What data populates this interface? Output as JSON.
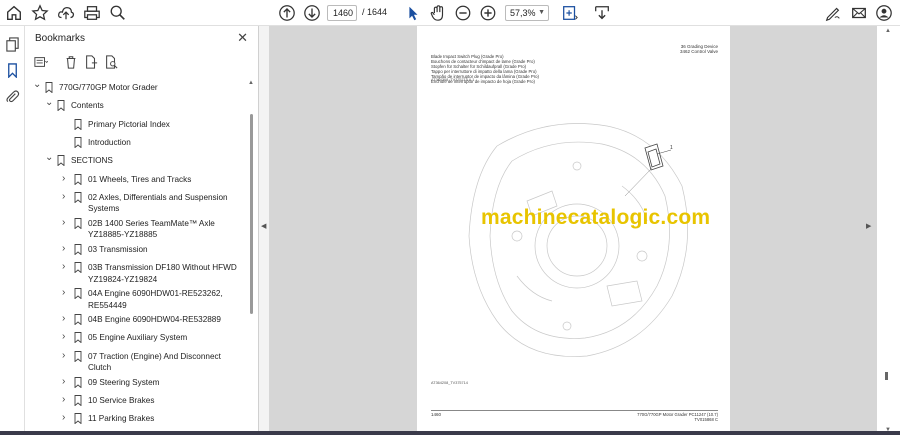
{
  "toolbar": {
    "page_current": "1460",
    "page_total": "/ 1644",
    "zoom": "57,3%",
    "icons": [
      "home-icon",
      "star-icon",
      "cloud-upload-icon",
      "print-icon",
      "search-icon",
      "arrow-up-circle-icon",
      "arrow-down-circle-icon",
      "cursor-icon",
      "hand-icon",
      "zoom-out-icon",
      "zoom-in-icon",
      "fit-page-icon",
      "save-icon",
      "pen-sign-icon",
      "email-icon",
      "account-icon"
    ]
  },
  "left_rail": {
    "icons": [
      "pages-icon",
      "bookmark-icon",
      "attachment-icon"
    ]
  },
  "bookmarks": {
    "title": "Bookmarks",
    "close": "✕",
    "items": [
      {
        "label": "770G/770GP Motor Grader",
        "level": 0,
        "state": "expanded"
      },
      {
        "label": "Contents",
        "level": 1,
        "state": "expanded"
      },
      {
        "label": "Primary Pictorial Index",
        "level": 2,
        "state": "leaf"
      },
      {
        "label": "Introduction",
        "level": 2,
        "state": "leaf"
      },
      {
        "label": "SECTIONS",
        "level": 1,
        "state": "expanded"
      },
      {
        "label": "01 Wheels, Tires and Tracks",
        "level": 2,
        "state": "collapsed"
      },
      {
        "label": "02 Axles, Differentials and Suspension",
        "label2": "Systems",
        "level": 2,
        "state": "collapsed"
      },
      {
        "label": "02B 1400 Series TeamMate™ Axle",
        "label2": "YZ18885-YZ18885",
        "level": 2,
        "state": "collapsed"
      },
      {
        "label": "03 Transmission",
        "level": 2,
        "state": "collapsed"
      },
      {
        "label": "03B Transmission DF180 Without HFWD",
        "label2": "YZ19824-YZ19824",
        "level": 2,
        "state": "collapsed"
      },
      {
        "label": "04A Engine 6090HDW01-RE523262,",
        "label2": "RE554449",
        "level": 2,
        "state": "collapsed"
      },
      {
        "label": "04B Engine 6090HDW04-RE532889",
        "level": 2,
        "state": "collapsed"
      },
      {
        "label": "05 Engine Auxiliary System",
        "level": 2,
        "state": "collapsed"
      },
      {
        "label": "07 Traction (Engine) And Disconnect",
        "label2": "Clutch",
        "level": 2,
        "state": "collapsed"
      },
      {
        "label": "09 Steering System",
        "level": 2,
        "state": "collapsed"
      },
      {
        "label": "10 Service Brakes",
        "level": 2,
        "state": "collapsed"
      },
      {
        "label": "11 Parking Brakes",
        "level": 2,
        "state": "collapsed"
      }
    ]
  },
  "pdf_page": {
    "header_right": [
      "36 Grading Device",
      "3462 Control Valve"
    ],
    "titles": [
      "Blade Impact Switch Plug (Grade Pro)",
      "Bouchons de contacteur d'impact de lame (Grade Pro)",
      "Stopfen für Schalter für Schildaufprall (Grade Pro)",
      "Tappo per interruttore di impatto della lama (Grade Pro)",
      "Tampão de interruptor de impacto da lâmina (Grade Pro)",
      "Enchufe de interruptor de impacto de hoja (Grade Pro)"
    ],
    "ref": "AT364208_TV375714 A.1",
    "callout": "1",
    "fig_ref": "AT364208_TV375714",
    "footer_left": "1460",
    "footer_right": [
      "770G/770GP Motor Grader   PC11247   (10.7)",
      "TV015868 C"
    ],
    "watermark": "machinecatalogic.com"
  }
}
